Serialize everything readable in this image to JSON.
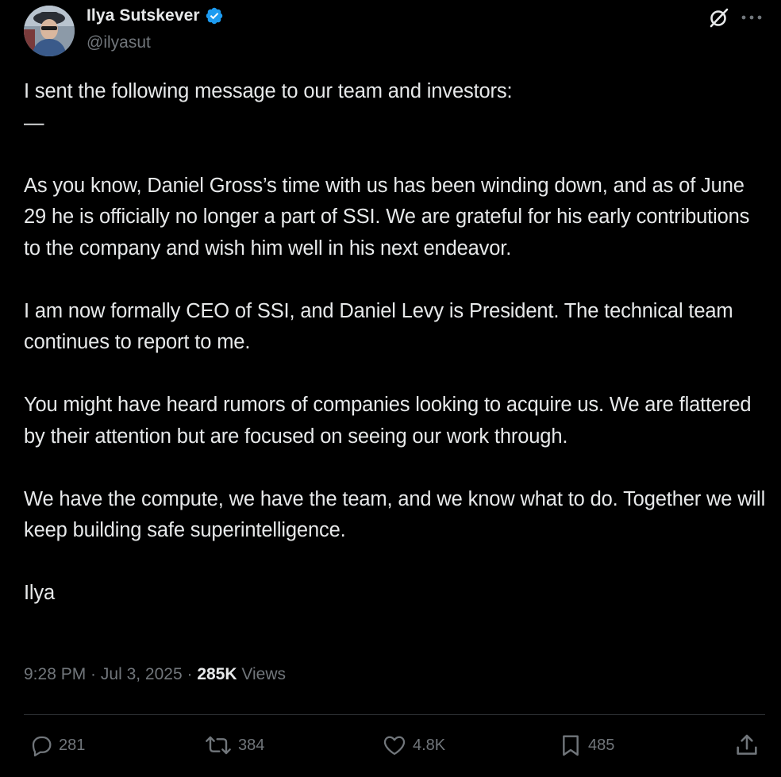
{
  "author": {
    "display_name": "Ilya Sutskever",
    "handle": "@ilyasut",
    "verified": true
  },
  "header_icons": [
    "grok-icon",
    "more-icon"
  ],
  "colors": {
    "background": "#000000",
    "text_primary": "#e7e9ea",
    "text_secondary": "#71767b",
    "verified_blue": "#1d9bf0",
    "divider": "#2f3336"
  },
  "body": {
    "intro": "I sent the following message to our team and investors:",
    "dash": "—",
    "paragraph_1": "As you know, Daniel Gross’s time with us has been winding down, and as of June 29 he is officially no longer a part of SSI. We are grateful for his early contributions to the company and wish him well in his next endeavor.",
    "paragraph_2": "I am now formally CEO of SSI, and Daniel Levy is President. The technical team continues to report to me.",
    "paragraph_3": "You might have heard rumors of companies looking to acquire us. We are flattered by their attention but are focused on seeing our work through.",
    "paragraph_4": "We have the compute, we have the team, and we know what to do. Together we will keep building safe superintelligence.",
    "signature": "Ilya"
  },
  "meta": {
    "time": "9:28 PM",
    "separator": " · ",
    "date": "Jul 3, 2025",
    "views_count": "285K",
    "views_label": " Views"
  },
  "actions": {
    "replies": "281",
    "reposts": "384",
    "likes": "4.8K",
    "bookmarks": "485"
  }
}
